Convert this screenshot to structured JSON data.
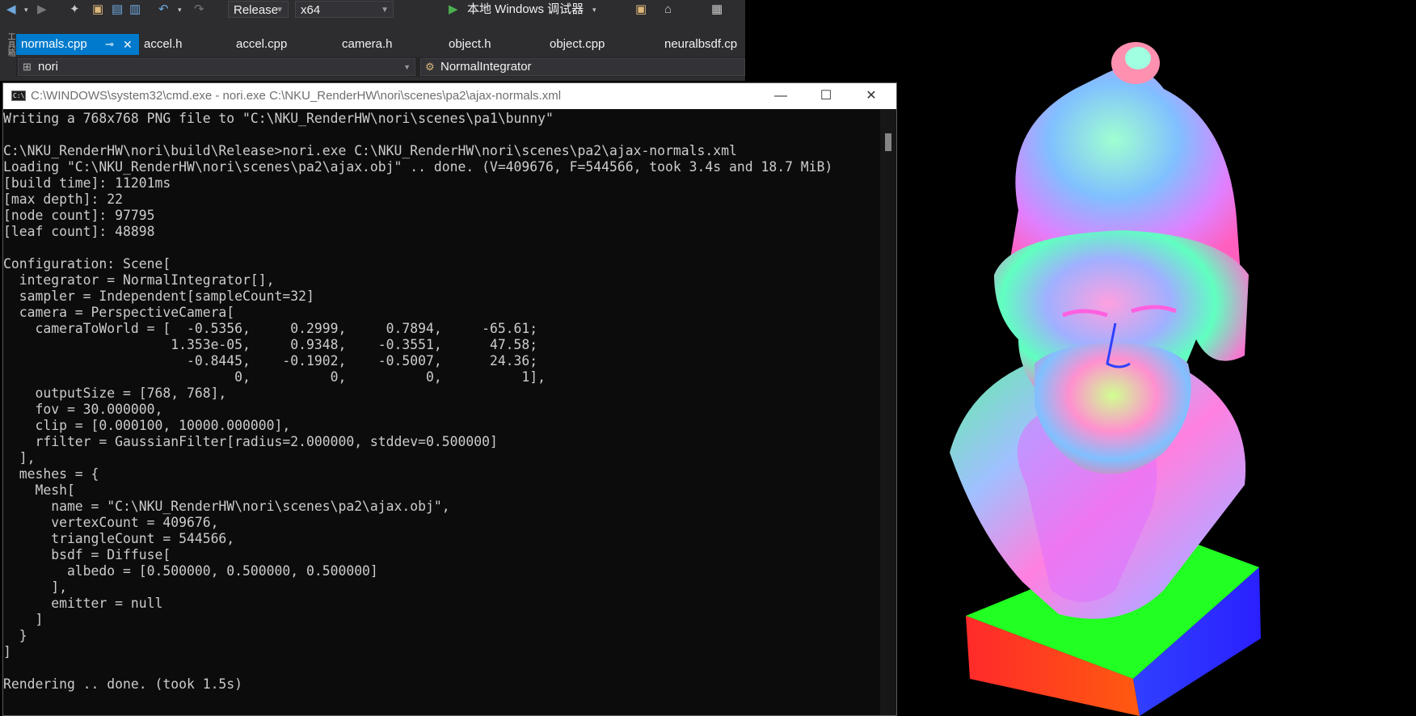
{
  "vs": {
    "config": "Release",
    "platform": "x64",
    "debugger": "本地 Windows 调试器",
    "left_rail": "工具箱",
    "tabs": [
      {
        "label": "normals.cpp",
        "active": true
      },
      {
        "label": "accel.h"
      },
      {
        "label": "accel.cpp"
      },
      {
        "label": "camera.h"
      },
      {
        "label": "object.h"
      },
      {
        "label": "object.cpp"
      },
      {
        "label": "neuralbsdf.cp"
      }
    ],
    "nav_project": "nori",
    "nav_class": "NormalIntegrator"
  },
  "cmd": {
    "title": "C:\\WINDOWS\\system32\\cmd.exe - nori.exe  C:\\NKU_RenderHW\\nori\\scenes\\pa2\\ajax-normals.xml",
    "lines": [
      "Writing a 768x768 PNG file to \"C:\\NKU_RenderHW\\nori\\scenes\\pa1\\bunny\"",
      "",
      "C:\\NKU_RenderHW\\nori\\build\\Release>nori.exe C:\\NKU_RenderHW\\nori\\scenes\\pa2\\ajax-normals.xml",
      "Loading \"C:\\NKU_RenderHW\\nori\\scenes\\pa2\\ajax.obj\" .. done. (V=409676, F=544566, took 3.4s and 18.7 MiB)",
      "[build time]: 11201ms",
      "[max depth]: 22",
      "[node count]: 97795",
      "[leaf count]: 48898",
      "",
      "Configuration: Scene[",
      "  integrator = NormalIntegrator[],",
      "  sampler = Independent[sampleCount=32]",
      "  camera = PerspectiveCamera[",
      "    cameraToWorld = [  -0.5356,     0.2999,     0.7894,     -65.61;",
      "                     1.353e-05,     0.9348,    -0.3551,      47.58;",
      "                       -0.8445,    -0.1902,    -0.5007,      24.36;",
      "                             0,          0,          0,          1],",
      "    outputSize = [768, 768],",
      "    fov = 30.000000,",
      "    clip = [0.000100, 10000.000000],",
      "    rfilter = GaussianFilter[radius=2.000000, stddev=0.500000]",
      "  ],",
      "  meshes = {",
      "    Mesh[",
      "      name = \"C:\\NKU_RenderHW\\nori\\scenes\\pa2\\ajax.obj\",",
      "      vertexCount = 409676,",
      "      triangleCount = 544566,",
      "      bsdf = Diffuse[",
      "        albedo = [0.500000, 0.500000, 0.500000]",
      "      ],",
      "      emitter = null",
      "    ]",
      "  }",
      "]",
      "",
      "Rendering .. done. (took 1.5s)"
    ]
  },
  "colors": {
    "vs_bg": "#2d2d30",
    "tab_active": "#007acc",
    "console_bg": "#0c0c0c",
    "console_text": "#cccccc"
  }
}
